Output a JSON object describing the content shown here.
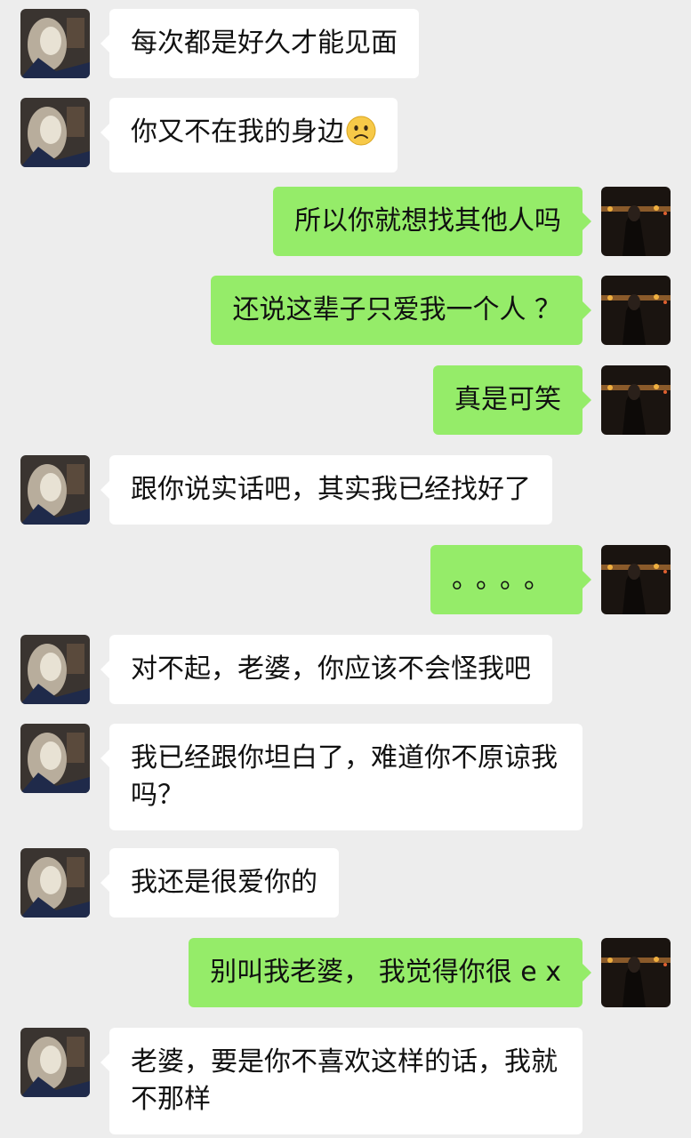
{
  "messages": [
    {
      "side": "in",
      "text": "每次都是好久才能见面"
    },
    {
      "side": "in",
      "text": "你又不在我的身边",
      "emoji": "frowning-face-icon"
    },
    {
      "side": "out",
      "text": "所以你就想找其他人吗"
    },
    {
      "side": "out",
      "text": "还说这辈子只爱我一个人 ？"
    },
    {
      "side": "out",
      "text": "真是可笑"
    },
    {
      "side": "in",
      "text": "跟你说实话吧，其实我已经找好了"
    },
    {
      "side": "out",
      "text": "。。。。"
    },
    {
      "side": "in",
      "text": "对不起，老婆，你应该不会怪我吧"
    },
    {
      "side": "in",
      "text": "我已经跟你坦白了，难道你不原谅我吗？"
    },
    {
      "side": "in",
      "text": "我还是很爱你的"
    },
    {
      "side": "out",
      "text": "别叫我老婆， 我觉得你很 e x"
    },
    {
      "side": "in",
      "text": "老婆，要是你不喜欢这样的话，我就不那样"
    }
  ],
  "colors": {
    "background": "#ededed",
    "incoming_bubble": "#ffffff",
    "outgoing_bubble": "#95ec69"
  }
}
